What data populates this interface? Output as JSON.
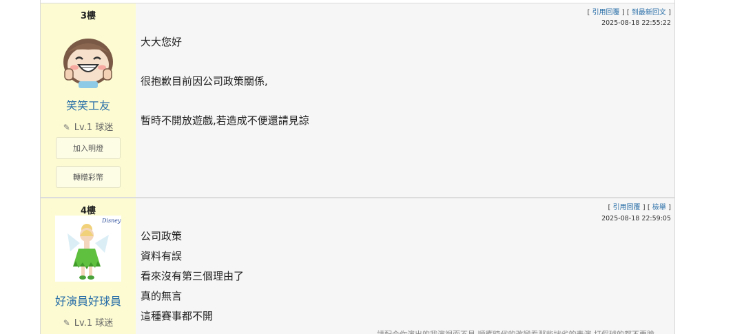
{
  "posts": [
    {
      "floor": "3樓",
      "username": "笑笑工友",
      "level": "Lv.1 球迷",
      "buttons": [
        "加入明燈",
        "轉贈彩幣"
      ],
      "actions": {
        "quote": "引用回覆",
        "second": "到最新回文"
      },
      "timestamp": "2025-08-18 22:55:22",
      "lines": [
        "大大您好",
        "很抱歉目前因公司政策關係,",
        "暫時不開放遊戲,若造成不便還請見諒"
      ]
    },
    {
      "floor": "4樓",
      "username": "好演員好球員",
      "level": "Lv.1 球迷",
      "avatar_badge": "Disney",
      "actions": {
        "quote": "引用回覆",
        "second": "檢舉"
      },
      "timestamp": "2025-08-18 22:59:05",
      "lines": [
        "公司政策",
        "資料有誤",
        "看來沒有第三個理由了",
        "真的無言",
        "這種賽事都不開"
      ],
      "signature": "請配合你演出的我演視而不見 順應時代的改變看那些拙劣的表演 打假球的都不要臉。"
    }
  ]
}
